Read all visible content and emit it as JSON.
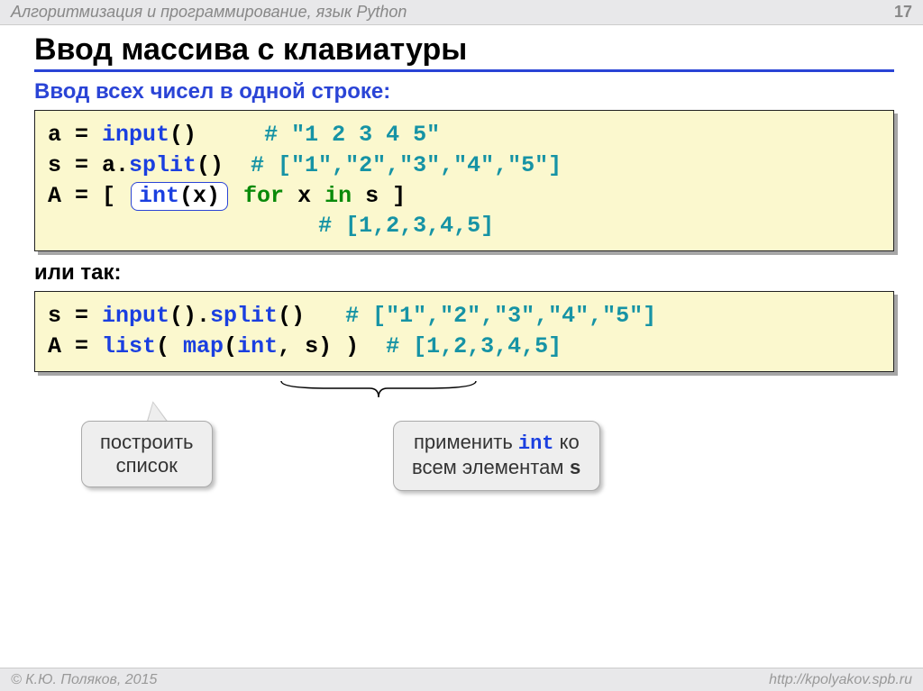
{
  "header": {
    "title": "Алгоритмизация и программирование, язык Python",
    "page": "17"
  },
  "footer": {
    "copyright": "© К.Ю. Поляков, 2015",
    "url": "http://kpolyakov.spb.ru"
  },
  "title": "Ввод массива с клавиатуры",
  "subhead": "Ввод всех чисел в одной строке:",
  "or_label": "или так:",
  "code1": {
    "l1a": "a = ",
    "l1b": "input",
    "l1c": "()     ",
    "l1d": "# \"1 2 3 4 5\"",
    "l2a": "s = a.",
    "l2b": "split",
    "l2c": "()  ",
    "l2d": "# [\"1\",\"2\",\"3\",\"4\",\"5\"]",
    "l3a": "A = [ ",
    "l3_box_a": "int",
    "l3_box_b": "(x)",
    "l3b": " for",
    "l3c": " x ",
    "l3d": "in",
    "l3e": " s ]",
    "l4pad": "                    ",
    "l4": "# [1,2,3,4,5]"
  },
  "code2": {
    "l1a": "s = ",
    "l1b": "input",
    "l1c": "().",
    "l1d": "split",
    "l1e": "()   ",
    "l1f": "# [\"1\",\"2\",\"3\",\"4\",\"5\"]",
    "l2a": "A = ",
    "l2b": "list",
    "l2c": "( ",
    "l2d": "map",
    "l2e": "(",
    "l2f": "int",
    "l2g": ", s) )  ",
    "l2h": "# [1,2,3,4,5]"
  },
  "callout1": {
    "line1": "построить",
    "line2": "список"
  },
  "callout2": {
    "pre": "применить ",
    "code": "int",
    "mid": " ко",
    "line2a": "всем элементам ",
    "line2b": "s"
  }
}
